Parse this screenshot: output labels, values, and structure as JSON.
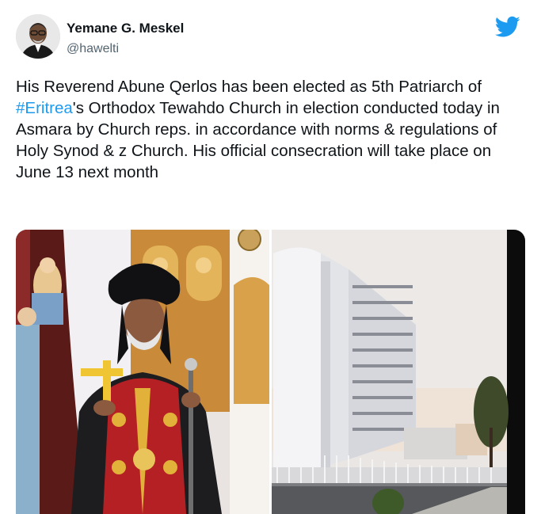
{
  "tweet": {
    "author_name": "Yemane G. Meskel",
    "author_handle": "@hawelti",
    "text_before": "His Reverend Abune Qerlos has been elected as 5th Patriarch of ",
    "hashtag": "#Eritrea",
    "text_after": "'s Orthodox Tewahdo Church in election conducted today in Asmara by Church reps. in accordance with norms & regulations of Holy Synod & z Church. His official consecration will take place on June 13 next month"
  },
  "icons": {
    "platform": "twitter-bird-icon"
  },
  "colors": {
    "brand": "#1d9bf0",
    "text": "#0f1419",
    "secondary": "#536471"
  }
}
